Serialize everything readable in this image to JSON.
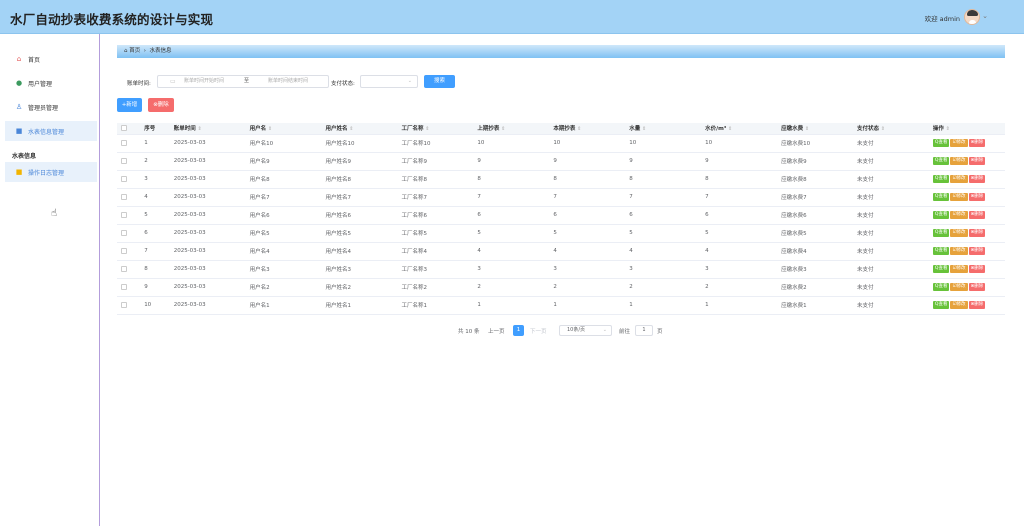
{
  "header": {
    "title": "水厂自动抄表收费系统的设计与实现",
    "welcome": "欢迎 admin"
  },
  "sidebar": {
    "items": [
      {
        "label": "首页",
        "icon": "home-icon",
        "color": "#e35b5b"
      },
      {
        "label": "用户管理",
        "icon": "user-icon",
        "color": "#3c9a5f"
      },
      {
        "label": "管理员管理",
        "icon": "admin-icon",
        "color": "#4a86d8"
      },
      {
        "label": "水表信息管理",
        "icon": "meter-icon",
        "color": "#4a86d8"
      }
    ],
    "section_label": "水表信息",
    "sub_item": {
      "label": "操作日志管理",
      "icon": "log-icon",
      "color": "#f2b400"
    }
  },
  "breadcrumb": {
    "home": "首页",
    "current": "水表信息"
  },
  "filters": {
    "bill_time_label": "账单时间:",
    "start_placeholder": "账单时间开始时间",
    "to": "至",
    "end_placeholder": "账单时间结束时间",
    "pay_status_label": "支付状态:",
    "search_label": "搜索"
  },
  "actions": {
    "add_label": "+新增",
    "delete_label": "⊗删除"
  },
  "table": {
    "headers": [
      "序号",
      "账单时间",
      "用户名",
      "用户姓名",
      "工厂名称",
      "上期抄表",
      "本期抄表",
      "水量",
      "水价/m³",
      "应缴水费",
      "支付状态",
      "操作"
    ],
    "rows": [
      [
        "1",
        "2025-03-03",
        "用户名10",
        "用户姓名10",
        "工厂名称10",
        "10",
        "10",
        "10",
        "10",
        "应缴水费10",
        "未支付"
      ],
      [
        "2",
        "2025-03-03",
        "用户名9",
        "用户姓名9",
        "工厂名称9",
        "9",
        "9",
        "9",
        "9",
        "应缴水费9",
        "未支付"
      ],
      [
        "3",
        "2025-03-03",
        "用户名8",
        "用户姓名8",
        "工厂名称8",
        "8",
        "8",
        "8",
        "8",
        "应缴水费8",
        "未支付"
      ],
      [
        "4",
        "2025-03-03",
        "用户名7",
        "用户姓名7",
        "工厂名称7",
        "7",
        "7",
        "7",
        "7",
        "应缴水费7",
        "未支付"
      ],
      [
        "5",
        "2025-03-03",
        "用户名6",
        "用户姓名6",
        "工厂名称6",
        "6",
        "6",
        "6",
        "6",
        "应缴水费6",
        "未支付"
      ],
      [
        "6",
        "2025-03-03",
        "用户名5",
        "用户姓名5",
        "工厂名称5",
        "5",
        "5",
        "5",
        "5",
        "应缴水费5",
        "未支付"
      ],
      [
        "7",
        "2025-03-03",
        "用户名4",
        "用户姓名4",
        "工厂名称4",
        "4",
        "4",
        "4",
        "4",
        "应缴水费4",
        "未支付"
      ],
      [
        "8",
        "2025-03-03",
        "用户名3",
        "用户姓名3",
        "工厂名称3",
        "3",
        "3",
        "3",
        "3",
        "应缴水费3",
        "未支付"
      ],
      [
        "9",
        "2025-03-03",
        "用户名2",
        "用户姓名2",
        "工厂名称2",
        "2",
        "2",
        "2",
        "2",
        "应缴水费2",
        "未支付"
      ],
      [
        "10",
        "2025-03-03",
        "用户名1",
        "用户姓名1",
        "工厂名称1",
        "1",
        "1",
        "1",
        "1",
        "应缴水费1",
        "未支付"
      ]
    ],
    "ops": {
      "view": "Q查看",
      "edit": "☑修改",
      "delete": "⊗删除"
    }
  },
  "pagination": {
    "total": "共 10 条",
    "prev": "上一页",
    "current": "1",
    "next": "下一页",
    "page_size": "10条/页",
    "goto": "前往",
    "goto_value": "1",
    "page_unit": "页"
  }
}
